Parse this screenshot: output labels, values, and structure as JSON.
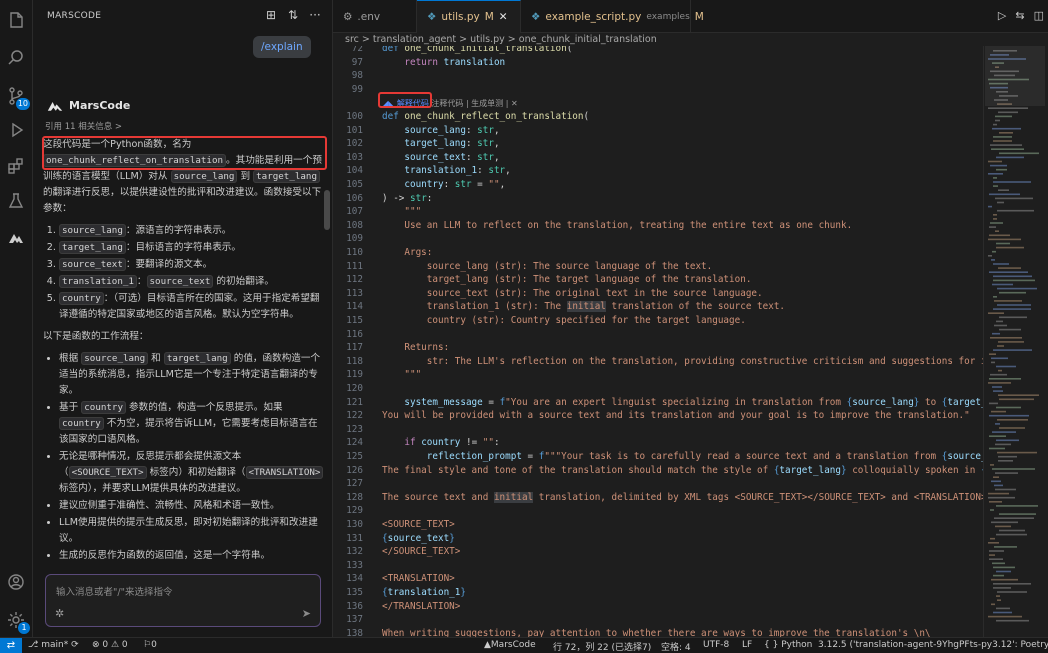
{
  "panel": {
    "title": "MARSCODE",
    "command_chip": "/explain",
    "assistant_name": "MarsCode",
    "refs": "引用 11 相关信息 >",
    "intro_pre": "这段代码是一个Python函数，名为 ",
    "intro_fn": "one_chunk_reflect_on_translation",
    "intro_mid": "。其功能是利用一个预训练的语言模型（LLM）对从 ",
    "intro_src": "source_lang",
    "intro_to": " 到 ",
    "intro_tgt": "target_lang",
    "intro_post": " 的翻译进行反思，以提供建设性的批评和改进建议。函数接受以下参数：",
    "params": [
      {
        "code": "source_lang",
        "text": "：源语言的字符串表示。"
      },
      {
        "code": "target_lang",
        "text": "：目标语言的字符串表示。"
      },
      {
        "code": "source_text",
        "text": "：要翻译的源文本。"
      },
      {
        "code": "translation_1",
        "code2": "source_text",
        "text": "：",
        "text2": " 的初始翻译。"
      },
      {
        "code": "country",
        "text": "：（可选）目标语言所在的国家。这用于指定希望翻译遵循的特定国家或地区的语言风格。默认为空字符串。"
      }
    ],
    "flow_title": "以下是函数的工作流程：",
    "flow": [
      {
        "pre": "根据 ",
        "c1": "source_lang",
        "mid": " 和 ",
        "c2": "target_lang",
        "post": " 的值，函数构造一个适当的系统消息，指示LLM它是一个专注于特定语言翻译的专家。"
      },
      {
        "pre": "基于 ",
        "c1": "country",
        "mid": " 参数的值，构造一个反思提示。如果 ",
        "c2": "country",
        "post": " 不为空，提示将告诉LLM，它需要考虑目标语言在该国家的口语风格。"
      },
      {
        "pre": "无论是哪种情况，反思提示都会提供源文本（",
        "c1": "<SOURCE_TEXT>",
        "mid": " 标签内）和初始翻译（",
        "c2": "<TRANSLATION>",
        "post": " 标签内），并要求LLM提供具体的改进建议。"
      },
      {
        "pre": "建议应侧重于准确性、流畅性、风格和术语一致性。"
      },
      {
        "pre": "LLM使用提供的提示生成反思，即对初始翻译的批评和改进建议。"
      },
      {
        "pre": "生成的反思作为函数的返回值，这是一个字符串。"
      }
    ],
    "input_placeholder": "输入消息或者\"/\"来选择指令"
  },
  "tabs": [
    {
      "label": ".env",
      "icon": "gear-icon"
    },
    {
      "label": "utils.py",
      "mod": "M",
      "active": true
    },
    {
      "label": "example_script.py",
      "sub": "examples",
      "mod": "M"
    }
  ],
  "breadcrumb": "src > translation_agent > utils.py > one_chunk_initial_translation",
  "codelens": {
    "explain": "解释代码",
    "comment": "注释代码 | 生成单测 | ✕"
  },
  "status": {
    "branch": "main*",
    "errors": "⊗ 0 ⚠ 0",
    "ports": "⚐0",
    "marscode": "MarsCode",
    "position": "行 72，列 22 (已选择7)",
    "spaces": "空格: 4",
    "encoding": "UTF-8",
    "eol": "LF",
    "language": "Python",
    "interpreter": "3.12.5 ('translation-agent-9YhgPFts-py3.12': Poetry)"
  },
  "badges": {
    "scm": "10",
    "account": "1"
  },
  "colors": {
    "accent": "#0078d4",
    "highlight_box": "#e53935"
  }
}
